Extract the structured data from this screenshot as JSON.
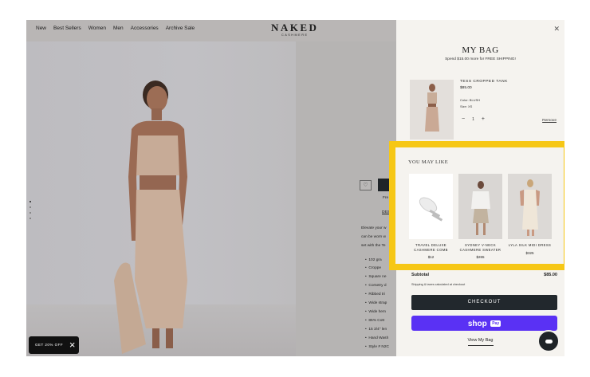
{
  "header": {
    "nav": [
      "New",
      "Best Sellers",
      "Women",
      "Men",
      "Accessories",
      "Archive Sale"
    ],
    "logo": "NAKED",
    "logo_sub": "CASHMERE"
  },
  "product": {
    "fragments": [
      "Fre",
      "DES",
      "Elevate your w",
      "can be worn w",
      "set with the Te"
    ],
    "bullets": [
      "102 gra",
      "Croppe",
      "Square ne",
      "Corsetry d",
      "Ribbed tri",
      "Wide strap",
      "Wide hem",
      "85% Cott",
      "15 3/4\" len",
      "Hand Wash",
      "Style # N2C"
    ]
  },
  "promo": {
    "label": "GET 20% OFF"
  },
  "bag": {
    "title": "MY BAG",
    "shipping": "Spend $15.00 more for FREE SHIPPING!",
    "item": {
      "name": "TESS CROPPED TANK",
      "price": "$85.00",
      "color": "Color: BLUSH",
      "size": "Size: XS",
      "qty": "1",
      "remove": "Remove"
    },
    "recommend_title": "YOU MAY LIKE",
    "recommendations": [
      {
        "name": "TRAVEL DELUXE CASHMERE COMB",
        "price": "$12"
      },
      {
        "name": "SYDNEY V-NECK CASHMERE SWEATER",
        "price": "$265"
      },
      {
        "name": "LYLA SILK MIDI DRESS",
        "price": "$325"
      }
    ],
    "subtotal_label": "Subtotal",
    "subtotal": "$85.00",
    "taxes": "Shipping & taxes calculated at checkout",
    "checkout": "CHECKOUT",
    "shoppay": "shop",
    "shoppay_badge": "Pay",
    "view_bag": "View My Bag"
  },
  "colors": {
    "accent": "#f6c716",
    "shoppay": "#5a31f4",
    "checkout": "#22282d"
  }
}
